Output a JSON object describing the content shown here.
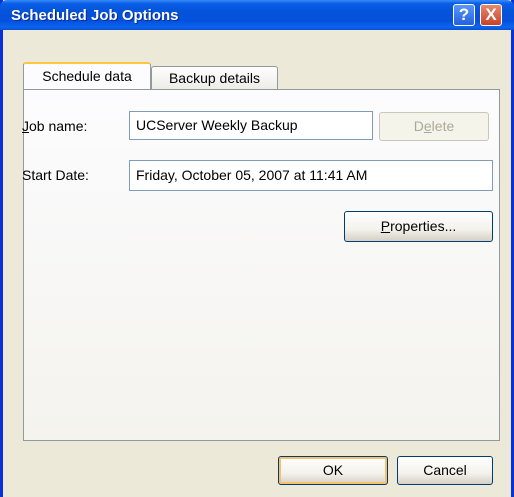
{
  "window": {
    "title": "Scheduled Job Options",
    "help_label": "?",
    "close_label": "X"
  },
  "tabs": [
    {
      "label": "Schedule data",
      "active": true
    },
    {
      "label": "Backup details",
      "active": false
    }
  ],
  "form": {
    "job_name": {
      "label_prefix": "",
      "label_mnemonic": "J",
      "label_suffix": "ob name:",
      "value": "UCServer Weekly Backup"
    },
    "start_date": {
      "label": "Start Date:",
      "value": "Friday, October 05, 2007 at 11:41 AM"
    }
  },
  "buttons": {
    "delete": {
      "prefix": "D",
      "mnemonic": "e",
      "suffix": "lete",
      "enabled": false
    },
    "properties": {
      "prefix": "",
      "mnemonic": "P",
      "suffix": "roperties..."
    },
    "ok": {
      "label": "OK"
    },
    "cancel": {
      "label": "Cancel"
    }
  },
  "colors": {
    "titlebar": "#0453d8",
    "dialog_face": "#ece9d8",
    "tab_highlight": "#ffc83c",
    "default_button_ring": "#f7c06a"
  }
}
